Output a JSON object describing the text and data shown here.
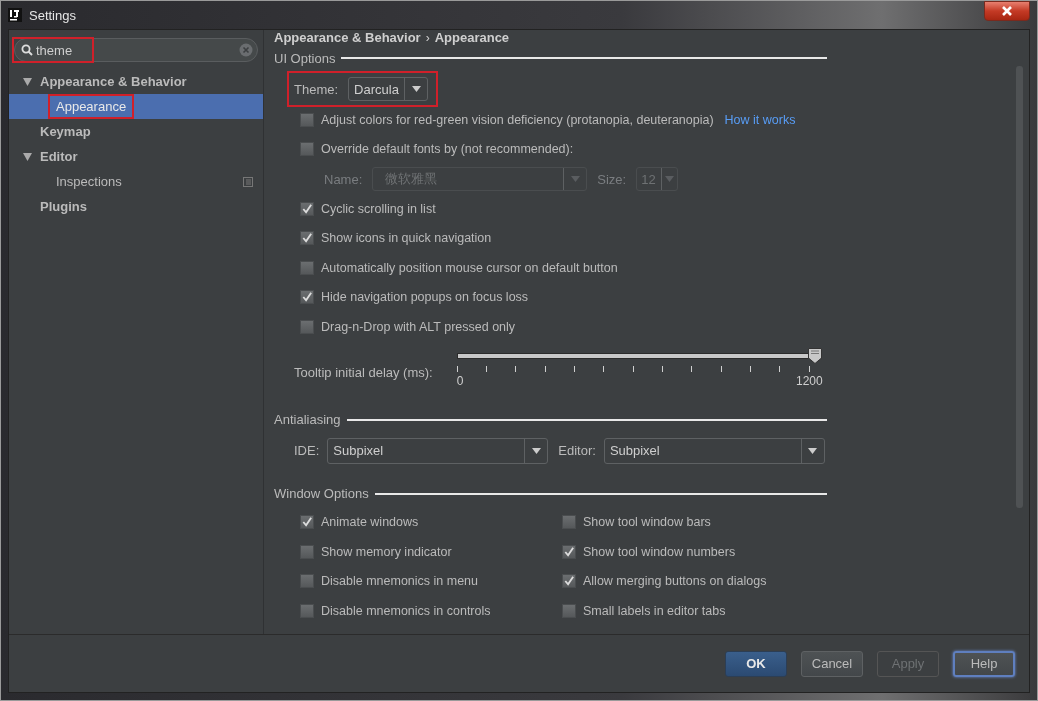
{
  "window": {
    "title": "Settings"
  },
  "search": {
    "value": "theme",
    "highlighted": true
  },
  "tree": [
    {
      "label": "Appearance & Behavior",
      "expanded": true,
      "selected": false,
      "children": [
        {
          "label": "Appearance",
          "selected": true,
          "highlighted": true
        }
      ]
    },
    {
      "label": "Keymap",
      "selected": false
    },
    {
      "label": "Editor",
      "expanded": true,
      "selected": false,
      "children": [
        {
          "label": "Inspections",
          "selected": false,
          "project_scoped": true
        }
      ]
    },
    {
      "label": "Plugins",
      "selected": false
    }
  ],
  "breadcrumb": {
    "items": [
      "Appearance & Behavior",
      "Appearance"
    ],
    "separator": "›"
  },
  "sections": [
    {
      "kind": "list",
      "title": "UI Options",
      "items": [
        {
          "kind": "dropdown",
          "label": "Theme:",
          "value": "Darcula",
          "highlighted": true
        },
        {
          "kind": "checkbox",
          "label": "Adjust colors for red-green vision deficiency (protanopia, deuteranopia)",
          "checked": false,
          "link": "How it works"
        },
        {
          "kind": "checkbox",
          "label": "Override default fonts by (not recommended):",
          "checked": false
        },
        {
          "kind": "font",
          "name_label": "Name:",
          "name_value": "微软雅黑",
          "size_label": "Size:",
          "size_value": "12",
          "disabled": true
        },
        {
          "kind": "checkbox",
          "label": "Cyclic scrolling in list",
          "checked": true
        },
        {
          "kind": "checkbox",
          "label": "Show icons in quick navigation",
          "checked": true
        },
        {
          "kind": "checkbox",
          "label": "Automatically position mouse cursor on default button",
          "checked": false
        },
        {
          "kind": "checkbox",
          "label": "Hide navigation popups on focus loss",
          "checked": true
        },
        {
          "kind": "checkbox",
          "label": "Drag-n-Drop with ALT pressed only",
          "checked": false
        },
        {
          "kind": "slider",
          "label": "Tooltip initial delay (ms):",
          "level": 1,
          "min_label": "0",
          "max_label": "1200"
        }
      ]
    },
    {
      "kind": "pair",
      "title": "Antialiasing",
      "items": [
        {
          "kind": "dropdown",
          "label": "IDE:",
          "value": "Subpixel"
        },
        {
          "kind": "dropdown",
          "label": "Editor:",
          "value": "Subpixel"
        }
      ]
    },
    {
      "kind": "grid",
      "title": "Window Options",
      "columns": [
        [
          {
            "kind": "checkbox",
            "label": "Animate windows",
            "checked": true
          },
          {
            "kind": "checkbox",
            "label": "Show memory indicator",
            "checked": false
          },
          {
            "kind": "checkbox",
            "label": "Disable mnemonics in menu",
            "checked": false
          },
          {
            "kind": "checkbox",
            "label": "Disable mnemonics in controls",
            "checked": false
          }
        ],
        [
          {
            "kind": "checkbox",
            "label": "Show tool window bars",
            "checked": false
          },
          {
            "kind": "checkbox",
            "label": "Show tool window numbers",
            "checked": true
          },
          {
            "kind": "checkbox",
            "label": "Allow merging buttons on dialogs",
            "checked": true
          },
          {
            "kind": "checkbox",
            "label": "Small labels in editor tabs",
            "checked": false
          }
        ]
      ]
    }
  ],
  "buttons": [
    {
      "label": "OK",
      "default": true,
      "disabled": false,
      "focused": false
    },
    {
      "label": "Cancel",
      "default": false,
      "disabled": false,
      "focused": false
    },
    {
      "label": "Apply",
      "default": false,
      "disabled": true,
      "focused": false
    },
    {
      "label": "Help",
      "default": false,
      "disabled": false,
      "focused": true
    }
  ]
}
